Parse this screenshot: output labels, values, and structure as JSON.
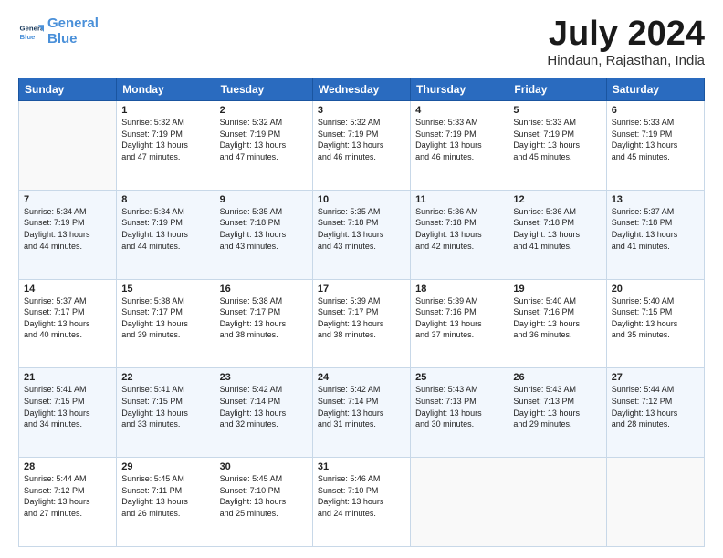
{
  "header": {
    "logo_line1": "General",
    "logo_line2": "Blue",
    "month_title": "July 2024",
    "location": "Hindaun, Rajasthan, India"
  },
  "columns": [
    "Sunday",
    "Monday",
    "Tuesday",
    "Wednesday",
    "Thursday",
    "Friday",
    "Saturday"
  ],
  "weeks": [
    [
      {
        "day": "",
        "info": ""
      },
      {
        "day": "1",
        "info": "Sunrise: 5:32 AM\nSunset: 7:19 PM\nDaylight: 13 hours\nand 47 minutes."
      },
      {
        "day": "2",
        "info": "Sunrise: 5:32 AM\nSunset: 7:19 PM\nDaylight: 13 hours\nand 47 minutes."
      },
      {
        "day": "3",
        "info": "Sunrise: 5:32 AM\nSunset: 7:19 PM\nDaylight: 13 hours\nand 46 minutes."
      },
      {
        "day": "4",
        "info": "Sunrise: 5:33 AM\nSunset: 7:19 PM\nDaylight: 13 hours\nand 46 minutes."
      },
      {
        "day": "5",
        "info": "Sunrise: 5:33 AM\nSunset: 7:19 PM\nDaylight: 13 hours\nand 45 minutes."
      },
      {
        "day": "6",
        "info": "Sunrise: 5:33 AM\nSunset: 7:19 PM\nDaylight: 13 hours\nand 45 minutes."
      }
    ],
    [
      {
        "day": "7",
        "info": "Sunrise: 5:34 AM\nSunset: 7:19 PM\nDaylight: 13 hours\nand 44 minutes."
      },
      {
        "day": "8",
        "info": "Sunrise: 5:34 AM\nSunset: 7:19 PM\nDaylight: 13 hours\nand 44 minutes."
      },
      {
        "day": "9",
        "info": "Sunrise: 5:35 AM\nSunset: 7:18 PM\nDaylight: 13 hours\nand 43 minutes."
      },
      {
        "day": "10",
        "info": "Sunrise: 5:35 AM\nSunset: 7:18 PM\nDaylight: 13 hours\nand 43 minutes."
      },
      {
        "day": "11",
        "info": "Sunrise: 5:36 AM\nSunset: 7:18 PM\nDaylight: 13 hours\nand 42 minutes."
      },
      {
        "day": "12",
        "info": "Sunrise: 5:36 AM\nSunset: 7:18 PM\nDaylight: 13 hours\nand 41 minutes."
      },
      {
        "day": "13",
        "info": "Sunrise: 5:37 AM\nSunset: 7:18 PM\nDaylight: 13 hours\nand 41 minutes."
      }
    ],
    [
      {
        "day": "14",
        "info": "Sunrise: 5:37 AM\nSunset: 7:17 PM\nDaylight: 13 hours\nand 40 minutes."
      },
      {
        "day": "15",
        "info": "Sunrise: 5:38 AM\nSunset: 7:17 PM\nDaylight: 13 hours\nand 39 minutes."
      },
      {
        "day": "16",
        "info": "Sunrise: 5:38 AM\nSunset: 7:17 PM\nDaylight: 13 hours\nand 38 minutes."
      },
      {
        "day": "17",
        "info": "Sunrise: 5:39 AM\nSunset: 7:17 PM\nDaylight: 13 hours\nand 38 minutes."
      },
      {
        "day": "18",
        "info": "Sunrise: 5:39 AM\nSunset: 7:16 PM\nDaylight: 13 hours\nand 37 minutes."
      },
      {
        "day": "19",
        "info": "Sunrise: 5:40 AM\nSunset: 7:16 PM\nDaylight: 13 hours\nand 36 minutes."
      },
      {
        "day": "20",
        "info": "Sunrise: 5:40 AM\nSunset: 7:15 PM\nDaylight: 13 hours\nand 35 minutes."
      }
    ],
    [
      {
        "day": "21",
        "info": "Sunrise: 5:41 AM\nSunset: 7:15 PM\nDaylight: 13 hours\nand 34 minutes."
      },
      {
        "day": "22",
        "info": "Sunrise: 5:41 AM\nSunset: 7:15 PM\nDaylight: 13 hours\nand 33 minutes."
      },
      {
        "day": "23",
        "info": "Sunrise: 5:42 AM\nSunset: 7:14 PM\nDaylight: 13 hours\nand 32 minutes."
      },
      {
        "day": "24",
        "info": "Sunrise: 5:42 AM\nSunset: 7:14 PM\nDaylight: 13 hours\nand 31 minutes."
      },
      {
        "day": "25",
        "info": "Sunrise: 5:43 AM\nSunset: 7:13 PM\nDaylight: 13 hours\nand 30 minutes."
      },
      {
        "day": "26",
        "info": "Sunrise: 5:43 AM\nSunset: 7:13 PM\nDaylight: 13 hours\nand 29 minutes."
      },
      {
        "day": "27",
        "info": "Sunrise: 5:44 AM\nSunset: 7:12 PM\nDaylight: 13 hours\nand 28 minutes."
      }
    ],
    [
      {
        "day": "28",
        "info": "Sunrise: 5:44 AM\nSunset: 7:12 PM\nDaylight: 13 hours\nand 27 minutes."
      },
      {
        "day": "29",
        "info": "Sunrise: 5:45 AM\nSunset: 7:11 PM\nDaylight: 13 hours\nand 26 minutes."
      },
      {
        "day": "30",
        "info": "Sunrise: 5:45 AM\nSunset: 7:10 PM\nDaylight: 13 hours\nand 25 minutes."
      },
      {
        "day": "31",
        "info": "Sunrise: 5:46 AM\nSunset: 7:10 PM\nDaylight: 13 hours\nand 24 minutes."
      },
      {
        "day": "",
        "info": ""
      },
      {
        "day": "",
        "info": ""
      },
      {
        "day": "",
        "info": ""
      }
    ]
  ]
}
